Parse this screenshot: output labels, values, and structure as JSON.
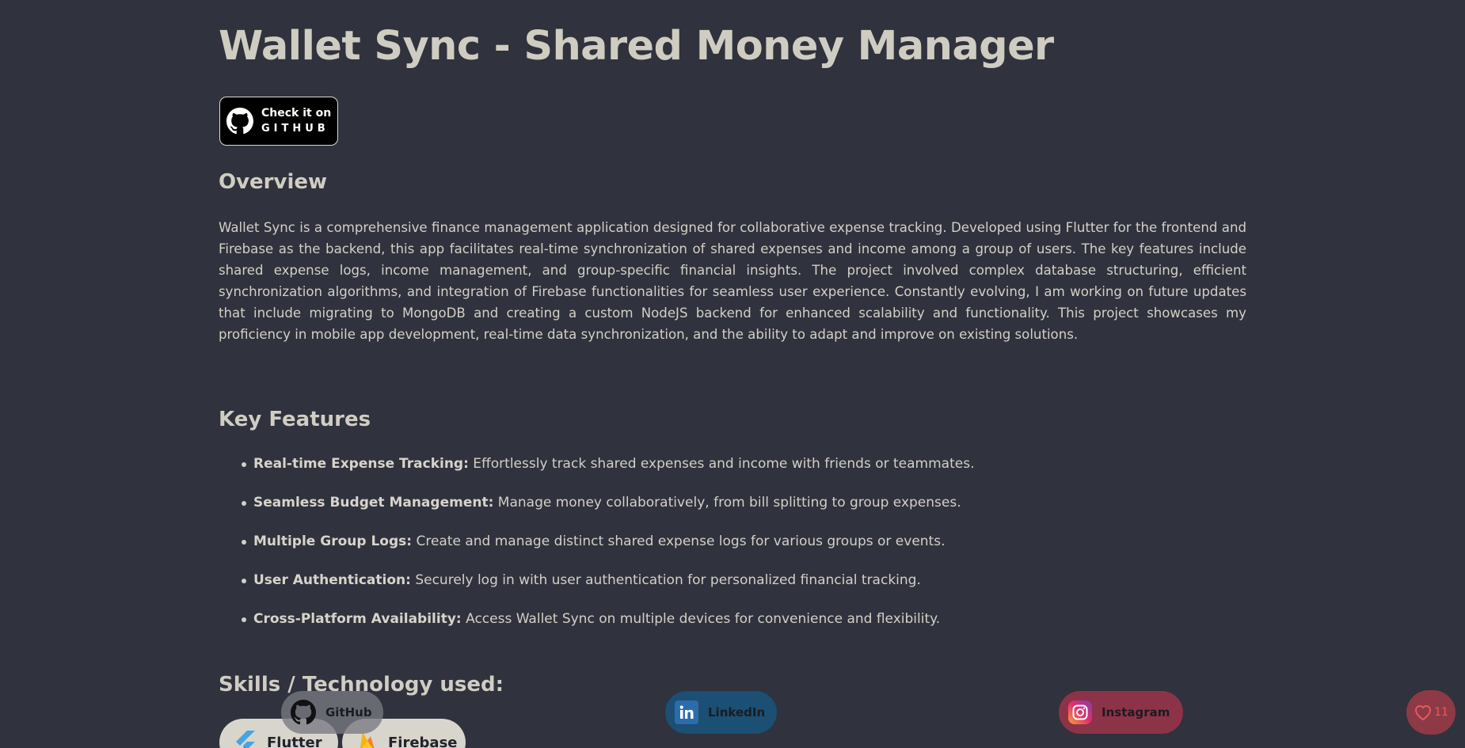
{
  "project": {
    "title": "Wallet Sync - Shared Money Manager",
    "github_badge": {
      "line1": "Check it on",
      "line2": "GITHUB"
    }
  },
  "overview": {
    "heading": "Overview",
    "text": "Wallet Sync is a comprehensive finance management application designed for collaborative expense tracking. Developed using Flutter for the frontend and Firebase as the backend, this app facilitates real-time synchronization of shared expenses and income among a group of users. The key features include shared expense logs, income management, and group-specific financial insights. The project involved complex database structuring, efficient synchronization algorithms, and integration of Firebase functionalities for seamless user experience. Constantly evolving, I am working on future updates that include migrating to MongoDB and creating a custom NodeJS backend for enhanced scalability and functionality. This project showcases my proficiency in mobile app development, real-time data synchronization, and the ability to adapt and improve on existing solutions."
  },
  "key_features": {
    "heading": "Key Features",
    "items": [
      {
        "title": "Real-time Expense Tracking:",
        "text": " Effortlessly track shared expenses and income with friends or teammates."
      },
      {
        "title": "Seamless Budget Management:",
        "text": " Manage money collaboratively, from bill splitting to group expenses."
      },
      {
        "title": "Multiple Group Logs:",
        "text": " Create and manage distinct shared expense logs for various groups or events."
      },
      {
        "title": "User Authentication:",
        "text": " Securely log in with user authentication for personalized financial tracking."
      },
      {
        "title": "Cross-Platform Availability:",
        "text": " Access Wallet Sync on multiple devices for convenience and flexibility."
      }
    ]
  },
  "skills": {
    "heading": "Skills / Technology used:",
    "items": [
      {
        "label": "Flutter",
        "icon": "flutter-icon"
      },
      {
        "label": "Firebase",
        "icon": "firebase-icon"
      }
    ]
  },
  "social": {
    "github": {
      "label": "GitHub",
      "icon": "github-icon"
    },
    "linkedin": {
      "label": "LinkedIn",
      "icon": "linkedin-icon"
    },
    "instagram": {
      "label": "Instagram",
      "icon": "instagram-icon"
    }
  },
  "like": {
    "count": "11",
    "icon": "heart-icon"
  },
  "colors": {
    "background": "#30323d",
    "text": "#d5d2c8",
    "linkedin": "#1b4f74",
    "instagram": "#8d3348",
    "like": "#8d3a46"
  }
}
